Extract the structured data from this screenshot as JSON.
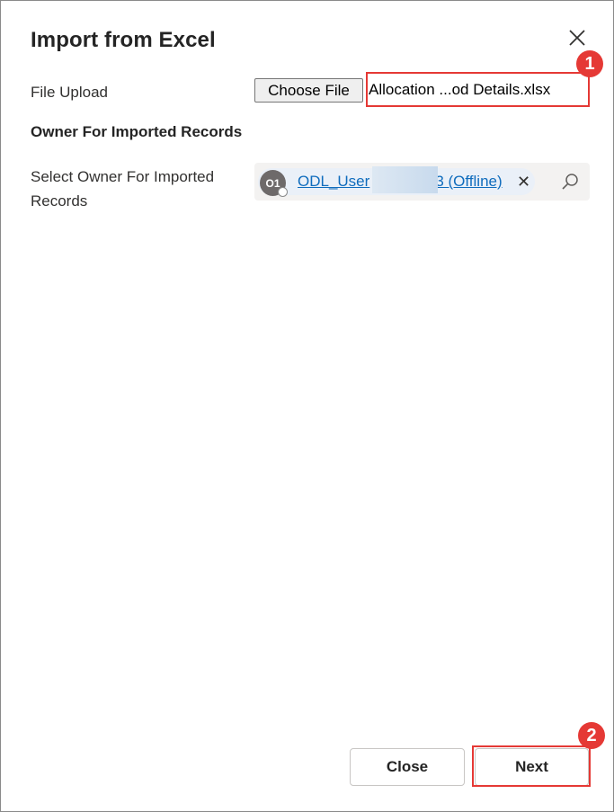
{
  "dialog": {
    "title": "Import from Excel",
    "close_icon": "close-icon"
  },
  "file_upload": {
    "label": "File Upload",
    "choose_button": "Choose File",
    "file_name": "Allocation ...od Details.xlsx"
  },
  "owner_section": {
    "heading": "Owner For Imported Records",
    "label": "Select Owner For Imported Records",
    "owner": {
      "initials": "O1",
      "name": "ODL_User",
      "suffix": "3 (Offline)"
    },
    "remove_icon": "remove-icon",
    "search_icon": "search-icon"
  },
  "footer": {
    "close_label": "Close",
    "next_label": "Next"
  },
  "annotations": {
    "badge_1": "1",
    "badge_2": "2",
    "color": "#e53935"
  }
}
